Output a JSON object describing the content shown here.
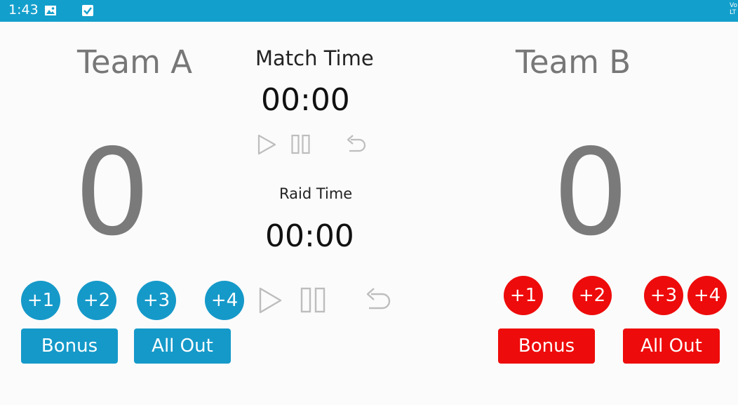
{
  "status_bar": {
    "time": "1:43",
    "icons": [
      "image-icon",
      "checkbox-icon"
    ],
    "right_text": "Vo LT"
  },
  "colors": {
    "status_bar": "#139fcc",
    "team_a": "#1599c9",
    "team_b": "#ee0b0b"
  },
  "team_a": {
    "name": "Team A",
    "score": "0",
    "points": [
      "+1",
      "+2",
      "+3",
      "+4"
    ],
    "bonus_label": "Bonus",
    "all_out_label": "All Out"
  },
  "team_b": {
    "name": "Team B",
    "score": "0",
    "points": [
      "+1",
      "+2",
      "+3",
      "+4"
    ],
    "bonus_label": "Bonus",
    "all_out_label": "All Out"
  },
  "match": {
    "label": "Match Time",
    "time": "00:00",
    "controls": [
      "play-icon",
      "pause-icon",
      "reset-icon"
    ]
  },
  "raid": {
    "label": "Raid Time",
    "time": "00:00",
    "controls": [
      "play-icon",
      "pause-icon",
      "reset-icon"
    ]
  }
}
